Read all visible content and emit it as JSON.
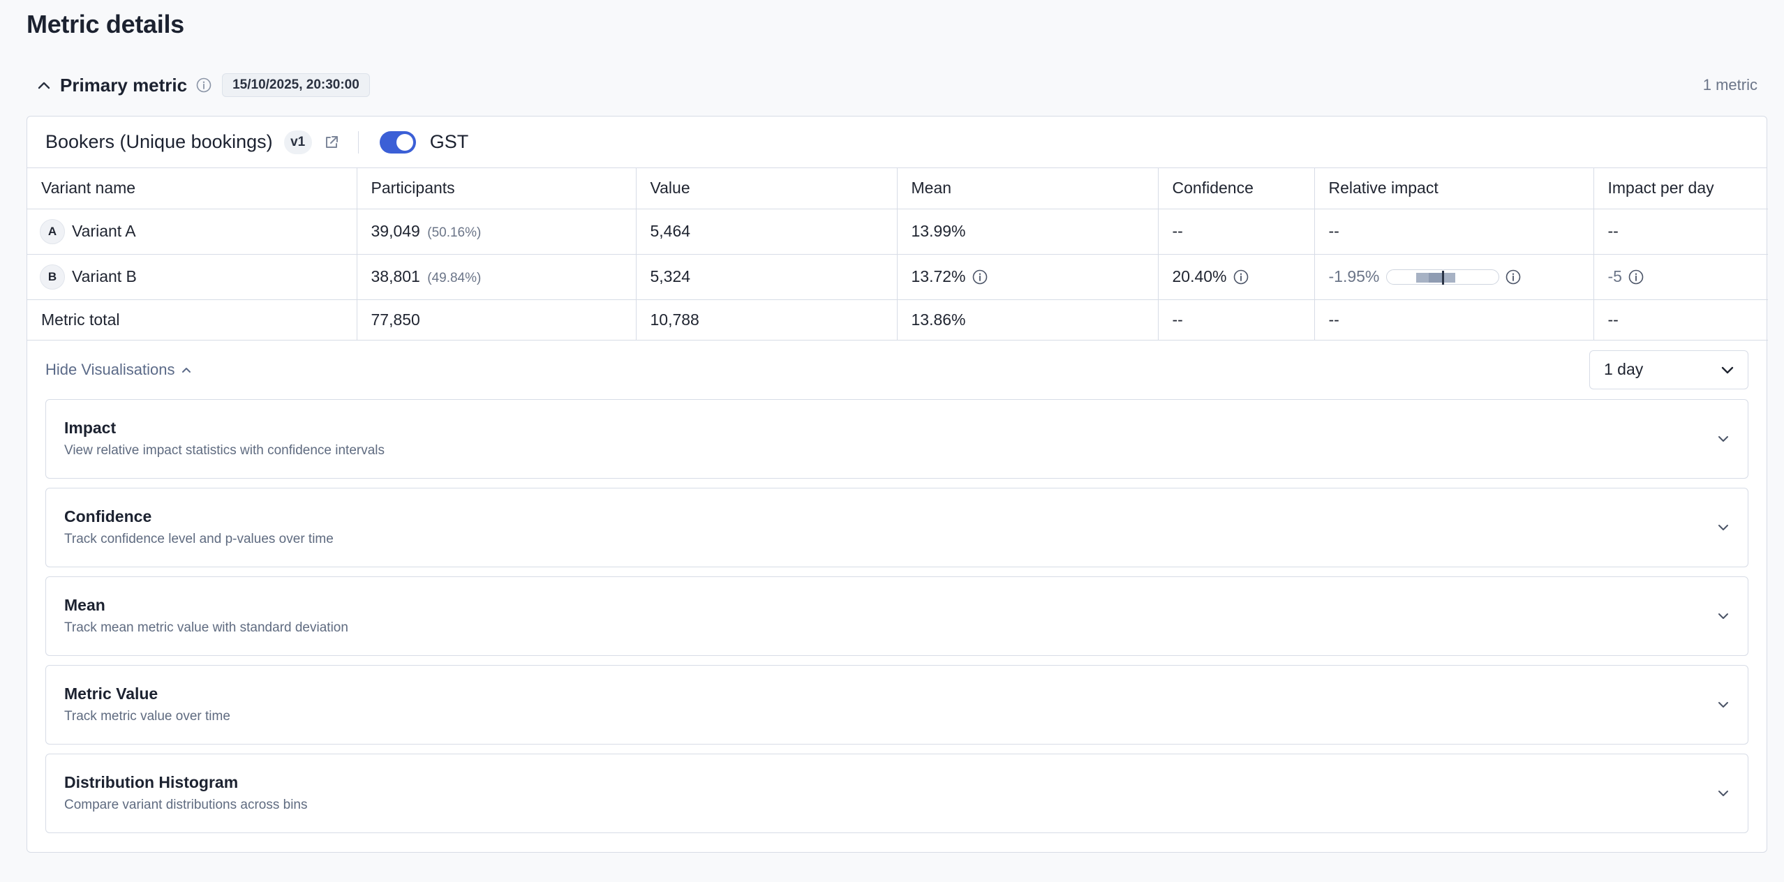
{
  "page": {
    "title": "Metric details"
  },
  "section": {
    "title": "Primary metric",
    "date": "15/10/2025, 20:30:00",
    "count": "1 metric"
  },
  "metric": {
    "name": "Bookers (Unique bookings)",
    "version": "v1",
    "toggle_label": "GST",
    "toggle_on": true
  },
  "table": {
    "headers": [
      "Variant name",
      "Participants",
      "Value",
      "Mean",
      "Confidence",
      "Relative impact",
      "Impact per day"
    ],
    "rows": [
      {
        "letter": "A",
        "name": "Variant A",
        "participants": "39,049",
        "participants_pct": "(50.16%)",
        "value": "5,464",
        "mean": "13.99%",
        "confidence": "--",
        "relative_impact": "--",
        "impact_per_day": "--"
      },
      {
        "letter": "B",
        "name": "Variant B",
        "participants": "38,801",
        "participants_pct": "(49.84%)",
        "value": "5,324",
        "mean": "13.72%",
        "confidence": "20.40%",
        "relative_impact": "-1.95%",
        "impact_per_day": "-5"
      }
    ],
    "total": {
      "label": "Metric total",
      "participants": "77,850",
      "value": "10,788",
      "mean": "13.86%",
      "confidence": "--",
      "relative_impact": "--",
      "impact_per_day": "--"
    }
  },
  "visualisations": {
    "toggle_label": "Hide Visualisations",
    "period": "1 day",
    "panels": [
      {
        "title": "Impact",
        "description": "View relative impact statistics with confidence intervals"
      },
      {
        "title": "Confidence",
        "description": "Track confidence level and p-values over time"
      },
      {
        "title": "Mean",
        "description": "Track mean metric value with standard deviation"
      },
      {
        "title": "Metric Value",
        "description": "Track metric value over time"
      },
      {
        "title": "Distribution Histogram",
        "description": "Compare variant distributions across bins"
      }
    ]
  },
  "colors": {
    "accent": "#3b5fd6",
    "muted_text": "#6b7588",
    "border": "#d7dce6"
  }
}
